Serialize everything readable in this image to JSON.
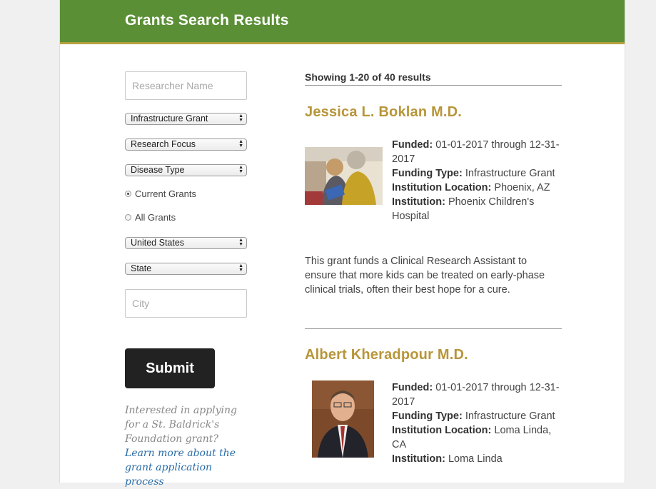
{
  "header": {
    "title": "Grants Search Results"
  },
  "sidebar": {
    "researcher_placeholder": "Researcher Name",
    "grant_type": "Infrastructure Grant",
    "research_focus": "Research Focus",
    "disease_type": "Disease Type",
    "radio_current": "Current Grants",
    "radio_all": "All Grants",
    "radio_selected": "Current Grants",
    "country": "United States",
    "state": "State",
    "city_placeholder": "City",
    "submit_label": "Submit",
    "help_text": "Interested in applying for a St. Baldrick's Foundation grant?",
    "help_link": "Learn more about the grant application process"
  },
  "results": {
    "count": "Showing 1-20 of 40 results",
    "items": [
      {
        "name": "Jessica L. Boklan M.D.",
        "funded_label": "Funded:",
        "funded": "01-01-2017 through 12-31-2017",
        "funding_type_label": "Funding Type:",
        "funding_type": "Infrastructure Grant",
        "location_label": "Institution Location:",
        "location": "Phoenix, AZ",
        "institution_label": "Institution:",
        "institution": "Phoenix Children's Hospital",
        "description": "This grant funds a Clinical Research Assistant to ensure that more kids can be treated on early-phase clinical trials, often their best hope for a cure."
      },
      {
        "name": "Albert Kheradpour M.D.",
        "funded_label": "Funded:",
        "funded": "01-01-2017 through 12-31-2017",
        "funding_type_label": "Funding Type:",
        "funding_type": "Infrastructure Grant",
        "location_label": "Institution Location:",
        "location": "Loma Linda, CA",
        "institution_label": "Institution:",
        "institution": "Loma Linda"
      }
    ]
  },
  "colors": {
    "header_green": "#5b8f36",
    "header_gold_border": "#b7a03e",
    "name_gold": "#b8953a",
    "link_blue": "#2a6ca8"
  }
}
